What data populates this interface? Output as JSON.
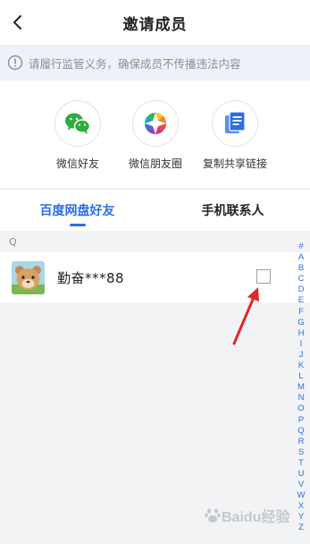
{
  "header": {
    "title": "邀请成员"
  },
  "notice": {
    "text": "请履行监管义务，确保成员不传播违法内容"
  },
  "share": {
    "items": [
      {
        "label": "微信好友",
        "icon": "wechat-icon"
      },
      {
        "label": "微信朋友圈",
        "icon": "wechat-moments-icon"
      },
      {
        "label": "复制共享链接",
        "icon": "copy-link-icon"
      }
    ]
  },
  "tabs": [
    {
      "label": "百度网盘好友",
      "active": true
    },
    {
      "label": "手机联系人",
      "active": false
    }
  ],
  "contacts": {
    "section_letter": "Q",
    "items": [
      {
        "name": "勤奋***88",
        "checked": false
      }
    ]
  },
  "alpha_index": [
    "#",
    "A",
    "B",
    "C",
    "D",
    "E",
    "F",
    "G",
    "H",
    "I",
    "J",
    "K",
    "L",
    "M",
    "N",
    "O",
    "P",
    "Q",
    "R",
    "S",
    "T",
    "U",
    "V",
    "W",
    "X",
    "Y",
    "Z"
  ],
  "watermark": {
    "text": "Baidu经验"
  },
  "colors": {
    "accent": "#2b6fe6",
    "arrow": "#e0272b",
    "wechat": "#2aae3e"
  }
}
